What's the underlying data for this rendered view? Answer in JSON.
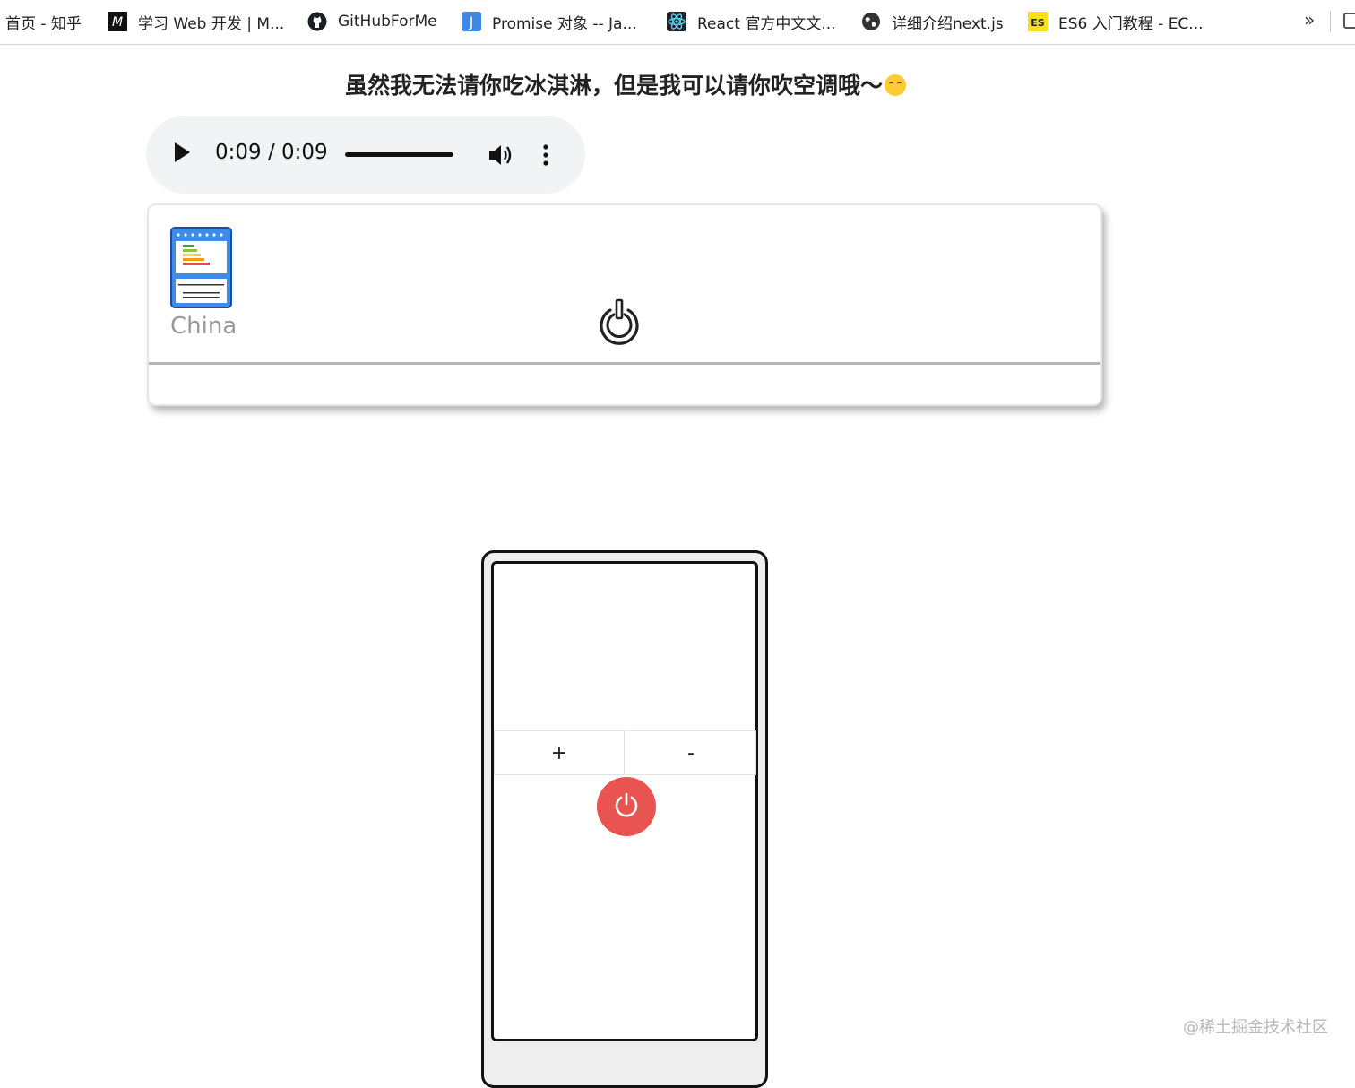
{
  "bookmarks": {
    "items": [
      {
        "label": "首页 - 知乎",
        "icon": "none"
      },
      {
        "label": "学习 Web 开发 | M...",
        "icon": "mdn-icon"
      },
      {
        "label": "GitHubForMe",
        "icon": "github-icon"
      },
      {
        "label": "Promise 对象 -- Ja...",
        "icon": "j-icon"
      },
      {
        "label": "React 官方中文文...",
        "icon": "react-icon"
      },
      {
        "label": "详细介绍next.js",
        "icon": "globe-icon"
      },
      {
        "label": "ES6 入门教程 - EC...",
        "icon": "es-icon"
      }
    ],
    "more_label": "»"
  },
  "headline": "虽然我无法请你吃冰淇淋，但是我可以请你吹空调哦～",
  "audio": {
    "current_time": "0:09",
    "separator": "/",
    "duration": "0:09",
    "progress": 1.0
  },
  "ac_unit": {
    "brand": "China"
  },
  "remote": {
    "plus_label": "+",
    "minus_label": "-"
  },
  "watermark": "@稀土掘金技术社区",
  "colors": {
    "power_button": "#ea5450",
    "audio_player_bg": "#f1f3f4",
    "es_badge": "#f7df1e",
    "j_badge": "#3f87e6"
  }
}
